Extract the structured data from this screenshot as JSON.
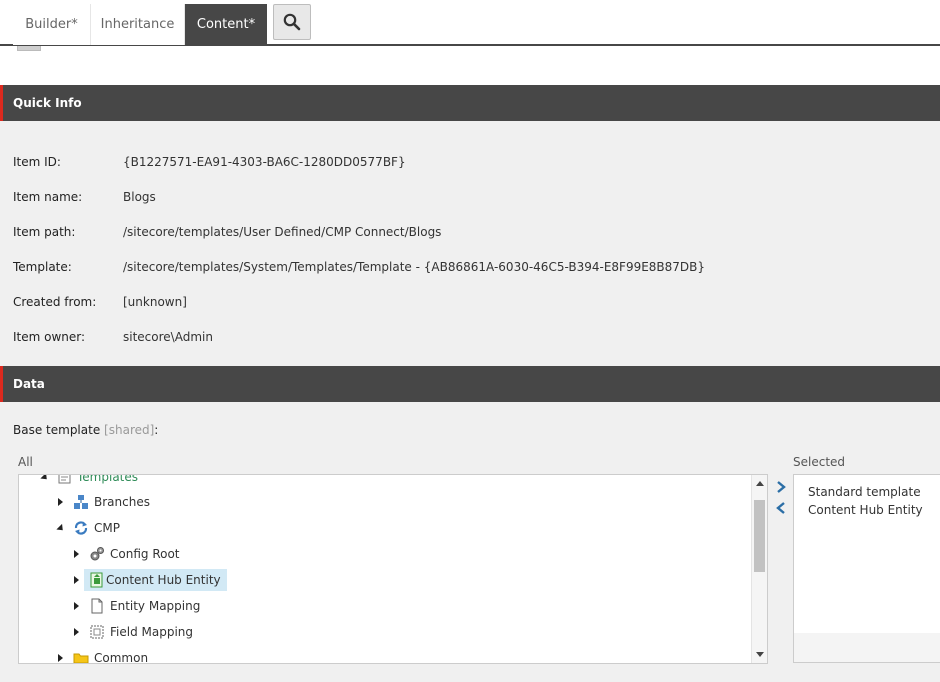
{
  "tabs": [
    {
      "label": "Builder*"
    },
    {
      "label": "Inheritance"
    },
    {
      "label": "Content*"
    }
  ],
  "quick_info": {
    "header": "Quick Info",
    "rows": [
      {
        "label": "Item ID:",
        "value": "{B1227571-EA91-4303-BA6C-1280DD0577BF}"
      },
      {
        "label": "Item name:",
        "value": "Blogs"
      },
      {
        "label": "Item path:",
        "value": "/sitecore/templates/User Defined/CMP Connect/Blogs"
      },
      {
        "label": "Template:",
        "value": "/sitecore/templates/System/Templates/Template - {AB86861A-6030-46C5-B394-E8F99E8B87DB}"
      },
      {
        "label": "Created from:",
        "value": "[unknown]"
      },
      {
        "label": "Item owner:",
        "value": "sitecore\\Admin"
      }
    ]
  },
  "data_section": {
    "header": "Data",
    "base_template_label": "Base template",
    "shared_tag": "[shared]",
    "colon": ":",
    "all_label": "All",
    "selected_label": "Selected"
  },
  "tree": {
    "items": [
      {
        "label": "Templates",
        "icon": "templates-icon"
      },
      {
        "label": "Branches",
        "icon": "branches-icon"
      },
      {
        "label": "CMP",
        "icon": "cmp-sync-icon"
      },
      {
        "label": "Config Root",
        "icon": "gears-icon"
      },
      {
        "label": "Content Hub Entity",
        "icon": "content-hub-entity-icon"
      },
      {
        "label": "Entity Mapping",
        "icon": "document-icon"
      },
      {
        "label": "Field Mapping",
        "icon": "field-mapping-icon"
      },
      {
        "label": "Common",
        "icon": "folder-icon"
      }
    ]
  },
  "selected_list": {
    "items": [
      "Standard template",
      "Content Hub Entity"
    ]
  },
  "colors": {
    "header_bg": "#474747",
    "accent_red": "#dc291e",
    "selection_bg": "#d2e9f5",
    "tree_link_green": "#2e8b57",
    "arrow_blue": "#2b6ea6"
  }
}
